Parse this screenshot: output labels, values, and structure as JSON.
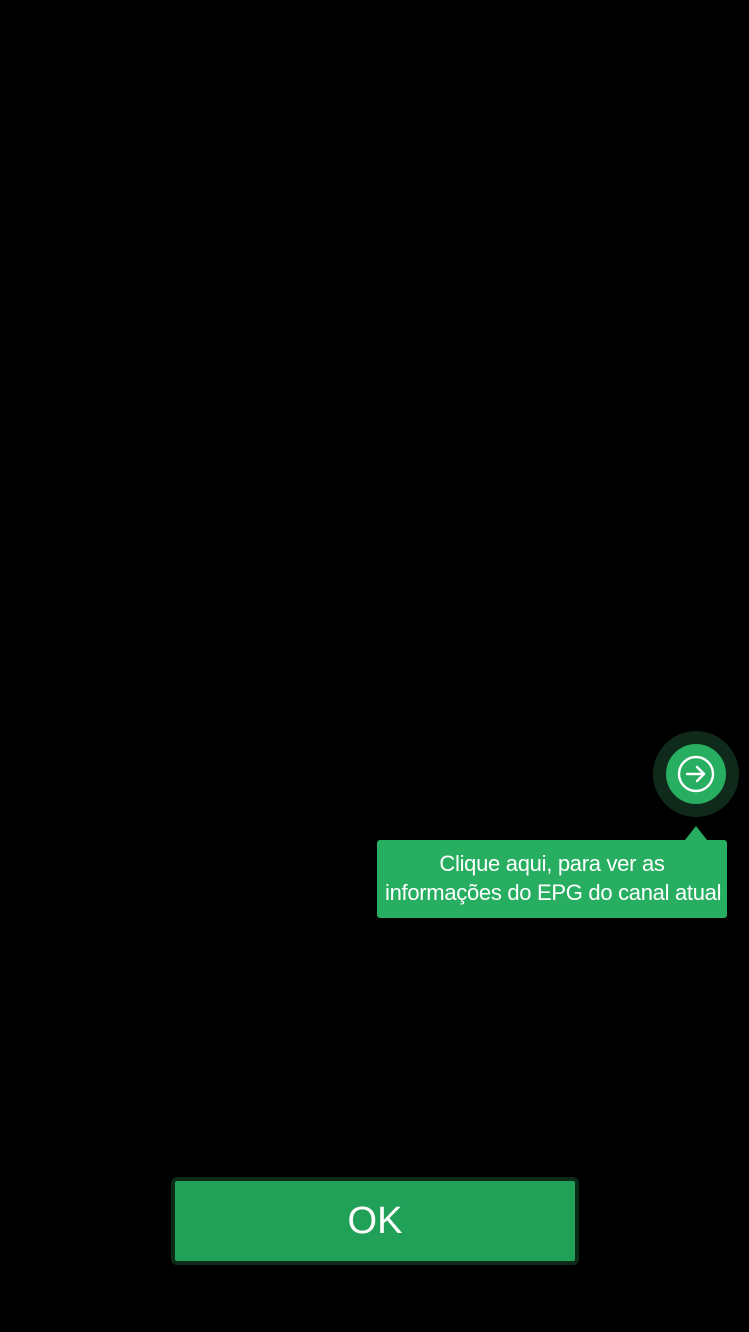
{
  "tooltip": {
    "line1": "Clique aqui, para ver as",
    "line2": "informações do EPG do canal atual"
  },
  "epg_button": {
    "icon": "arrow-right-circle-icon"
  },
  "ok_button": {
    "label": "OK"
  },
  "colors": {
    "background": "#000000",
    "accent_green": "#27ae60",
    "button_green": "#21a157",
    "halo": "#0f2a1a",
    "button_border": "#0b2a17",
    "text": "#ffffff"
  }
}
